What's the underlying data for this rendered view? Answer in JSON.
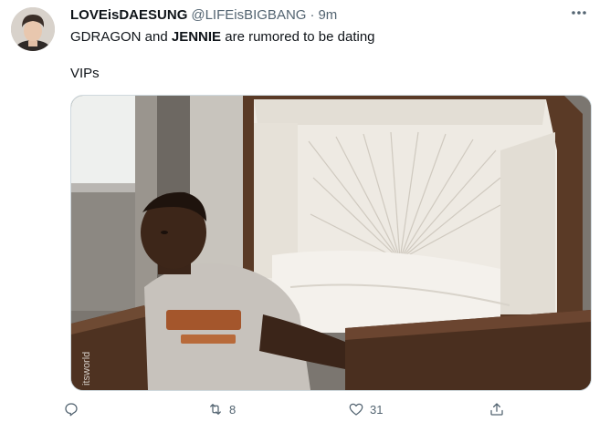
{
  "author": {
    "display_name": "LOVEisDAESUNG",
    "handle": "@LIFEisBIGBANG",
    "separator": "·",
    "time": "9m"
  },
  "text": {
    "line1_part1": "GDRAGON and ",
    "line1_bold": "JENNIE",
    "line1_part2": " are rumored to be dating",
    "line2": "VIPs"
  },
  "media": {
    "watermark": "itsworld"
  },
  "actions": {
    "reply_count": "",
    "retweet_count": "8",
    "like_count": "31"
  },
  "icons": {
    "more": "more-horizontal-icon",
    "reply": "reply-icon",
    "retweet": "retweet-icon",
    "like": "heart-icon",
    "share": "share-icon"
  },
  "colors": {
    "text_primary": "#0f1419",
    "text_secondary": "#536471",
    "border": "#cfd9de"
  }
}
